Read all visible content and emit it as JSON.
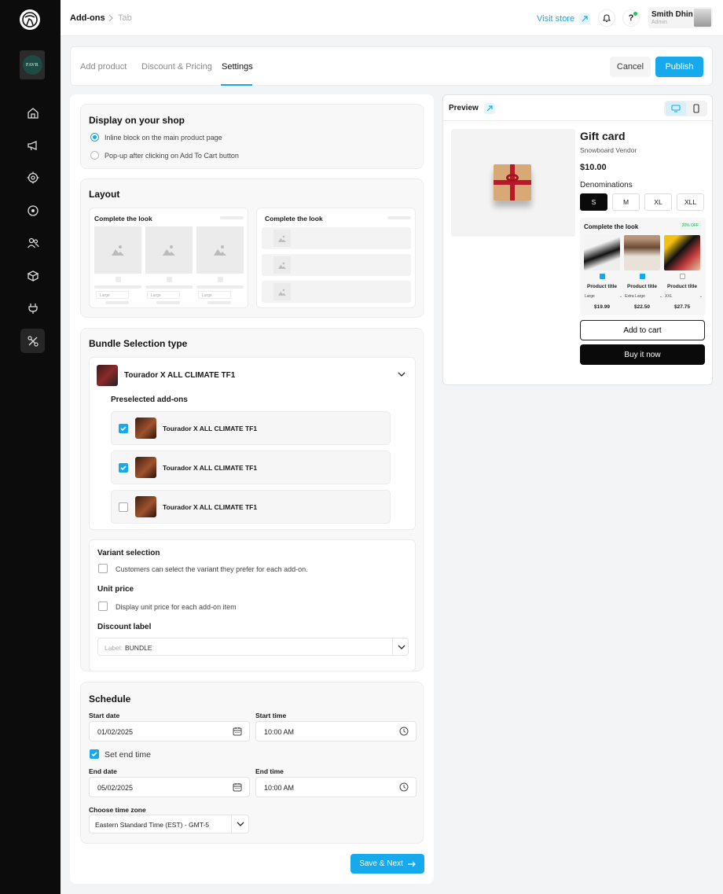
{
  "sidebar": {
    "store_badge": "FAVR",
    "items": [
      {
        "icon": "home-icon"
      },
      {
        "icon": "megaphone-icon"
      },
      {
        "icon": "target-icon"
      },
      {
        "icon": "record-icon"
      },
      {
        "icon": "users-icon"
      },
      {
        "icon": "box-icon"
      },
      {
        "icon": "plug-icon"
      },
      {
        "icon": "addons-icon",
        "active": true
      }
    ]
  },
  "topbar": {
    "breadcrumb": [
      "Add-ons",
      "Tab"
    ],
    "visit_store": "Visit store",
    "help_label": "?",
    "user": {
      "name": "Smith Dhin",
      "role": "Admin"
    }
  },
  "tabs": {
    "items": [
      "Add product",
      "Discount & Pricing",
      "Settings"
    ],
    "active": "Settings",
    "cancel": "Cancel",
    "publish": "Publish"
  },
  "display": {
    "title": "Display on your shop",
    "options": [
      "Inline block on the main product page",
      "Pop-up after clicking on Add To Cart button"
    ],
    "selected": 0
  },
  "layout": {
    "title": "Layout",
    "grid_title": "Complete the look",
    "list_title": "Complete the look",
    "variant_placeholder": "Large"
  },
  "bundle": {
    "title": "Bundle Selection type",
    "product": "Tourador X ALL CLIMATE TF1",
    "preselected_title": "Preselected add-ons",
    "addons": [
      {
        "name": "Tourador X ALL CLIMATE TF1",
        "checked": true
      },
      {
        "name": "Tourador X ALL CLIMATE TF1",
        "checked": true
      },
      {
        "name": "Tourador X ALL CLIMATE TF1",
        "checked": false
      }
    ],
    "variant_title": "Variant selection",
    "variant_label": "Customers can select the variant they prefer for each add-on.",
    "unit_title": "Unit price",
    "unit_label": "Display unit price for each add-on item",
    "discount_title": "Discount label",
    "discount_prefix": "Label:",
    "discount_value": "BUNDLE"
  },
  "schedule": {
    "title": "Schedule",
    "start_date_label": "Start date",
    "start_date": "01/02/2025",
    "start_time_label": "Start time",
    "start_time": "10:00 AM",
    "set_end_time": "Set end time",
    "end_date_label": "End date",
    "end_date": "05/02/2025",
    "end_time_label": "End time",
    "end_time": "10:00 AM",
    "timezone_label": "Choose time zone",
    "timezone": "Eastern Standard Time (EST) - GMT-5"
  },
  "save_next": "Save & Next",
  "preview": {
    "title": "Preview",
    "product_name": "Gift card",
    "vendor": "Snowboard Vendor",
    "price": "$10.00",
    "denominations_label": "Denominations",
    "sizes": [
      "S",
      "M",
      "XL",
      "XLL"
    ],
    "selected_size": "S",
    "ctl_title": "Complete the look",
    "ctl_badge": "20% OFF",
    "items": [
      {
        "title": "Product title",
        "variant": "Large",
        "price": "$19.99",
        "checked": true
      },
      {
        "title": "Product title",
        "variant": "Extra Large",
        "price": "$22.50",
        "checked": true
      },
      {
        "title": "Product title",
        "variant": "XXL",
        "price": "$27.75",
        "checked": false
      }
    ],
    "add_to_cart": "Add to cart",
    "buy_now": "Buy it now"
  },
  "colors": {
    "accent": "#16a9ec",
    "sidebar": "#0c0c0c",
    "dark_button": "#0a0a0a",
    "success": "#22c55e"
  }
}
